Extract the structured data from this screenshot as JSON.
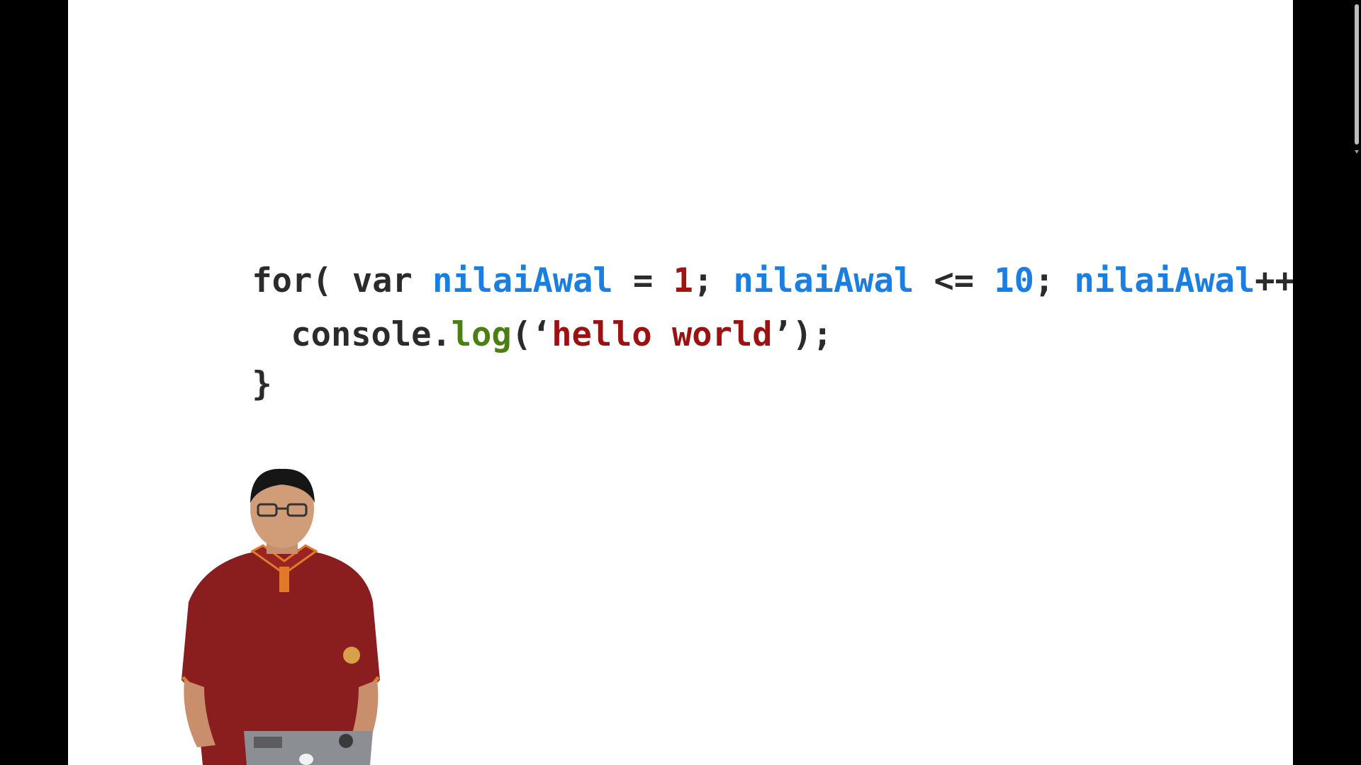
{
  "slide": {
    "code": {
      "line1": [
        {
          "text": "for(",
          "kind": "plain"
        },
        {
          "text": " var ",
          "kind": "plain"
        },
        {
          "text": "nilaiAwal",
          "kind": "ident"
        },
        {
          "text": " = ",
          "kind": "plain"
        },
        {
          "text": "1",
          "kind": "num-red"
        },
        {
          "text": "; ",
          "kind": "plain"
        },
        {
          "text": "nilaiAwal",
          "kind": "ident"
        },
        {
          "text": " <= ",
          "kind": "plain"
        },
        {
          "text": "10",
          "kind": "num-blue"
        },
        {
          "text": "; ",
          "kind": "plain"
        },
        {
          "text": "nilaiAwal",
          "kind": "ident"
        },
        {
          "text": "++ ) {",
          "kind": "plain"
        }
      ],
      "line2": [
        {
          "text": "console.",
          "kind": "plain"
        },
        {
          "text": "log",
          "kind": "method"
        },
        {
          "text": "(‘",
          "kind": "plain"
        },
        {
          "text": "hello world",
          "kind": "string"
        },
        {
          "text": "’);",
          "kind": "plain"
        }
      ],
      "line3": "}"
    }
  },
  "colors": {
    "background": "#000000",
    "slide": "#ffffff",
    "code_text": "#2b2b2b",
    "identifier": "#1a7fe0",
    "number": "#a01414",
    "method": "#4a7f12",
    "string": "#9c1212",
    "shirt": "#8a1d1d",
    "laptop": "#8b8e93"
  },
  "icons": {
    "presenter": "presenter-figure",
    "watermark": "channel-watermark-icon",
    "scroll_down": "chevron-down-icon"
  }
}
